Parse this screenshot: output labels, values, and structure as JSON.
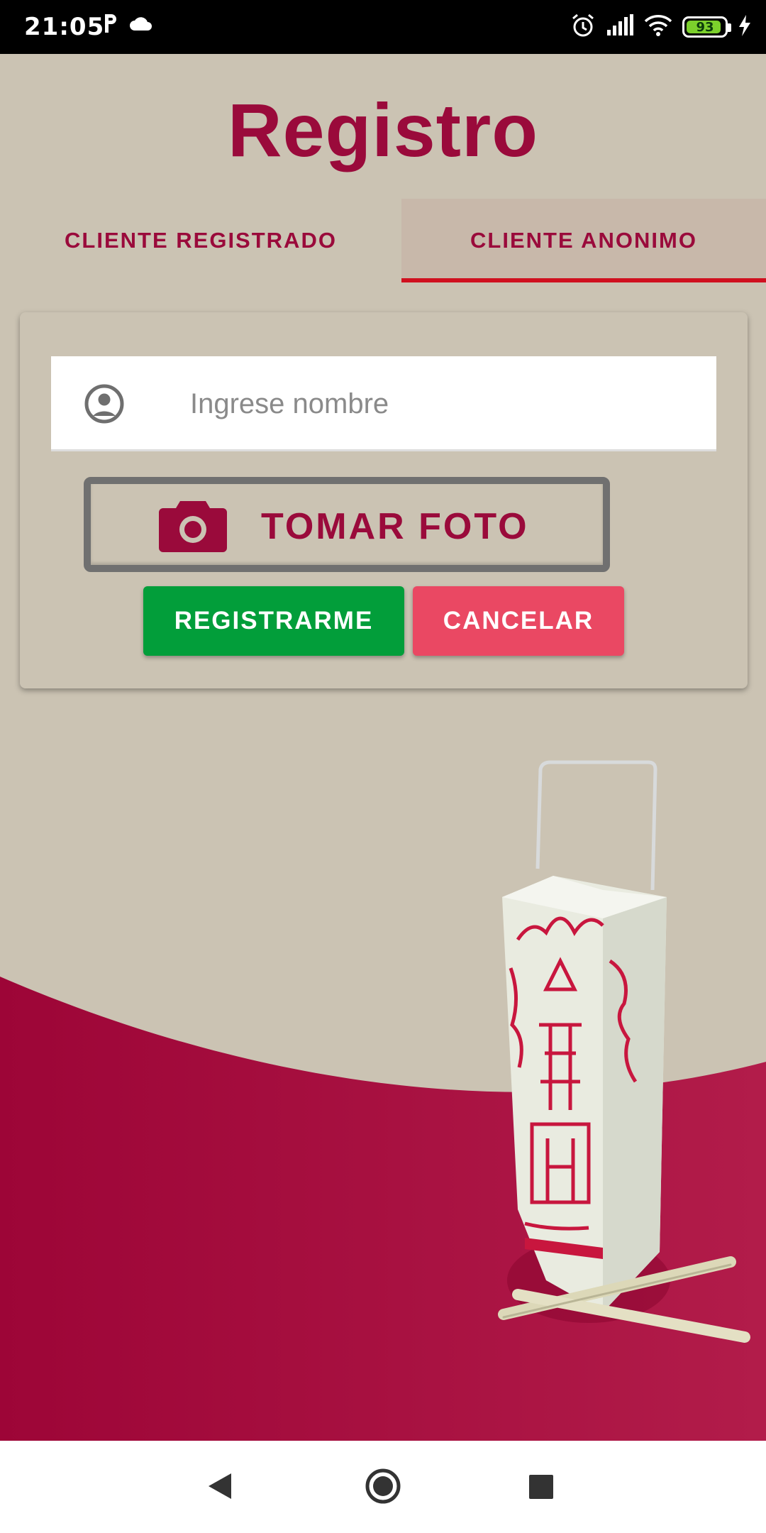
{
  "status_bar": {
    "time": "21:05",
    "left_icons": [
      "parking-icon",
      "cloud-icon"
    ],
    "right_icons": [
      "alarm-icon",
      "signal-icon",
      "wifi-icon",
      "battery-icon",
      "charging-icon"
    ],
    "battery_percent": "93",
    "battery_level": 0.93
  },
  "header": {
    "title": "Registro"
  },
  "tabs": [
    {
      "label": "CLIENTE REGISTRADO",
      "selected": false
    },
    {
      "label": "CLIENTE ANONIMO",
      "selected": true
    }
  ],
  "form": {
    "name_input": {
      "value": "",
      "placeholder": "Ingrese nombre",
      "icon": "user-circle-icon"
    },
    "photo_button": {
      "label": "TOMAR FOTO",
      "icon": "camera-icon"
    },
    "register_button": {
      "label": "REGISTRARME"
    },
    "cancel_button": {
      "label": "CANCELAR"
    }
  },
  "colors": {
    "primary": "#9a0a3b",
    "background": "#cbc3b3",
    "tab_selected_bg": "#c8b8aa",
    "tab_indicator": "#d0101f",
    "register_green": "#029e3a",
    "cancel_pink": "#ea4863"
  },
  "nav_bar": {
    "buttons": [
      "back-icon",
      "home-icon",
      "recents-icon"
    ]
  }
}
